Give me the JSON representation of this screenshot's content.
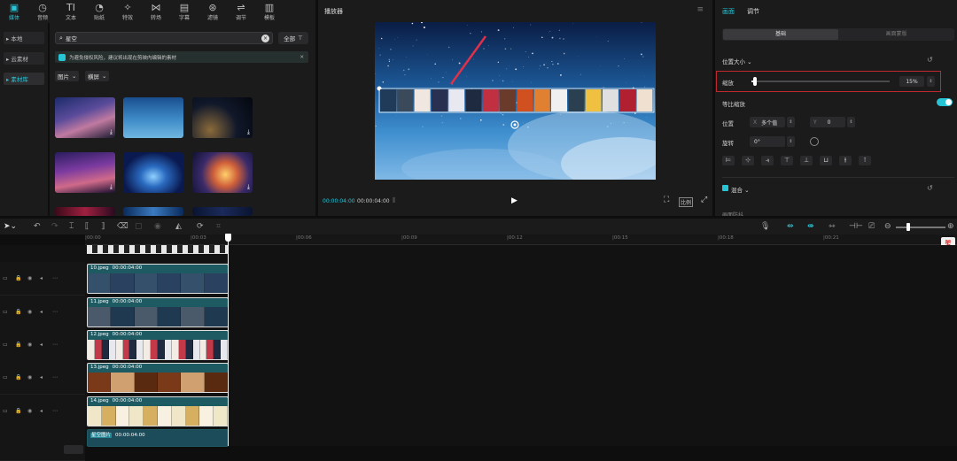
{
  "toolbar": {
    "items": [
      {
        "label": "媒体",
        "icon": "media-icon",
        "glyph": "▣"
      },
      {
        "label": "音频",
        "icon": "audio-icon",
        "glyph": "◷"
      },
      {
        "label": "文本",
        "icon": "text-icon",
        "glyph": "TI"
      },
      {
        "label": "贴纸",
        "icon": "sticker-icon",
        "glyph": "◔"
      },
      {
        "label": "特效",
        "icon": "effects-icon",
        "glyph": "✧"
      },
      {
        "label": "转场",
        "icon": "transition-icon",
        "glyph": "⋈"
      },
      {
        "label": "字幕",
        "icon": "caption-icon",
        "glyph": "▤"
      },
      {
        "label": "滤镜",
        "icon": "filter-icon",
        "glyph": "⊛"
      },
      {
        "label": "调节",
        "icon": "adjust-icon",
        "glyph": "⇌"
      },
      {
        "label": "模板",
        "icon": "template-icon",
        "glyph": "▥"
      }
    ]
  },
  "leftnav": {
    "items": [
      {
        "label": "▸ 本地"
      },
      {
        "label": "▸ 云素材"
      },
      {
        "label": "▸ 素材库"
      }
    ]
  },
  "library": {
    "search_value": "星空",
    "filter_label": "全部",
    "notice": "为避免侵权风险，建议将出现在剪映内编辑的素材",
    "type_dd": "图片",
    "orient_dd": "横屏"
  },
  "player": {
    "title": "播放器",
    "time_current": "00:00:04:00",
    "time_total": "00:00:04:00",
    "ratio_label": "比例"
  },
  "props": {
    "tab_picture": "画面",
    "tab_adjust": "调节",
    "seg_basic": "基础",
    "seg_bg": "画面蒙版",
    "section_pos_size": "位置大小",
    "scale_label": "缩放",
    "scale_value": "15%",
    "scale_fraction": 0.15,
    "uniform_label": "等比缩放",
    "position_label": "位置",
    "x_label": "X",
    "x_value": "多个值",
    "y_label": "Y",
    "y_value": "0",
    "rotate_label": "旋转",
    "rotate_value": "0°",
    "blend_label": "混合",
    "partial_label": "画面防抖"
  },
  "timeline": {
    "ruler": [
      "|00:00",
      "|00:03",
      "|00:06",
      "|00:09",
      "|00:12",
      "|00:15",
      "|00:18",
      "|00:21"
    ],
    "clips": [
      {
        "name": "10.jpeg",
        "duration": "00:00:04:00"
      },
      {
        "name": "11.jpeg",
        "duration": "00:00:04:00"
      },
      {
        "name": "12.jpeg",
        "duration": "00:00:04:00"
      },
      {
        "name": "13.jpeg",
        "duration": "00:00:04:00"
      },
      {
        "name": "14.jpeg",
        "duration": "00:00:04:00"
      },
      {
        "name": "星空图片",
        "duration": "00:00:04:00"
      }
    ]
  }
}
